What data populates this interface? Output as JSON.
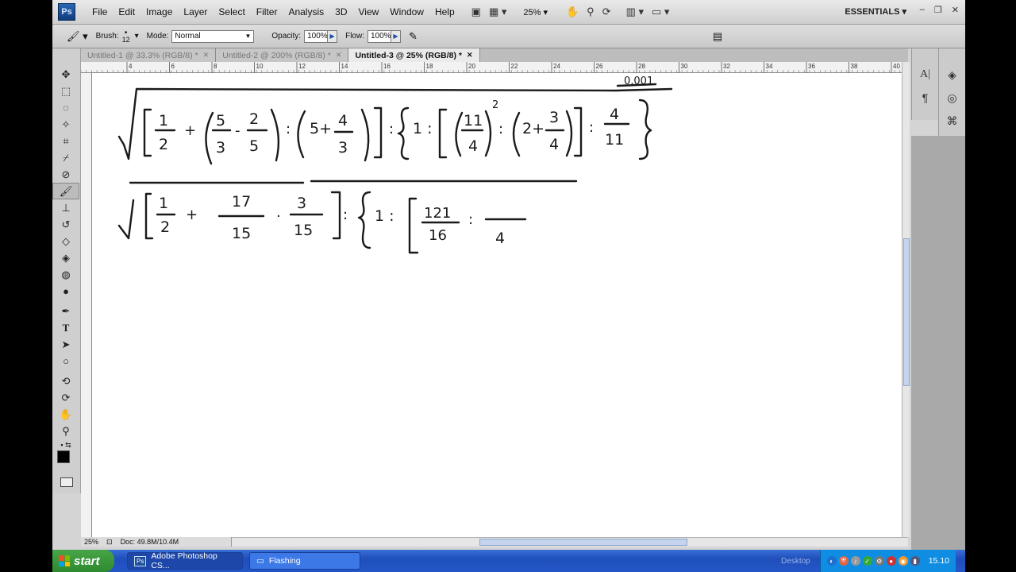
{
  "app": {
    "logo": "Ps",
    "workspace": "ESSENTIALS"
  },
  "menu": [
    "File",
    "Edit",
    "Image",
    "Layer",
    "Select",
    "Filter",
    "Analysis",
    "3D",
    "View",
    "Window",
    "Help"
  ],
  "menubar": {
    "zoom": "25%"
  },
  "options": {
    "brush_label": "Brush:",
    "brush_size": "12",
    "mode_label": "Mode:",
    "mode_value": "Normal",
    "opacity_label": "Opacity:",
    "opacity_value": "100%",
    "flow_label": "Flow:",
    "flow_value": "100%"
  },
  "tabs": [
    {
      "label": "Untitled-1 @ 33.3% (RGB/8) *"
    },
    {
      "label": "Untitled-2 @ 200% (RGB/8) *"
    },
    {
      "label": "Untitled-3 @ 25% (RGB/8) *"
    }
  ],
  "ruler_top": [
    "4",
    "6",
    "8",
    "10",
    "12",
    "14",
    "16",
    "18",
    "20",
    "22",
    "24",
    "26",
    "28",
    "30",
    "32",
    "34",
    "36",
    "38",
    "40"
  ],
  "status": {
    "zoom": "25%",
    "doc": "Doc: 49.8M/10.4M"
  },
  "canvas": {
    "annotation": "0,001",
    "row1": {
      "open_br": "[",
      "f1n": "1",
      "f1d": "2",
      "plus1": "+",
      "f2n": "5",
      "f2d": "3",
      "minus": "-",
      "f3n": "2",
      "f3d": "5",
      "colon1": ":",
      "five_plus": "5+",
      "f4n": "4",
      "f4d": "3",
      "colon2": ":",
      "one_colon": "1 :",
      "f5n": "11",
      "f5d": "4",
      "exp": "2",
      "colon3": ":",
      "two_plus": "2+",
      "f6n": "3",
      "f6d": "4",
      "colon4": ":",
      "f7n": "4",
      "f7d": "11"
    },
    "row2": {
      "f1n": "1",
      "f1d": "2",
      "plus": "+",
      "f2n": "17",
      "f2d": "15",
      "dot": "·",
      "f3n": "3",
      "f3d": "15",
      "colon1": ":",
      "one_colon": "1 :",
      "f4n": "121",
      "f4d": "16",
      "colon2": ":",
      "f5d": "4"
    }
  },
  "taskbar": {
    "start": "start",
    "buttons": [
      {
        "label": "Adobe Photoshop CS..."
      },
      {
        "label": "Flashing"
      }
    ],
    "desktop": "Desktop",
    "clock": "15.10"
  }
}
